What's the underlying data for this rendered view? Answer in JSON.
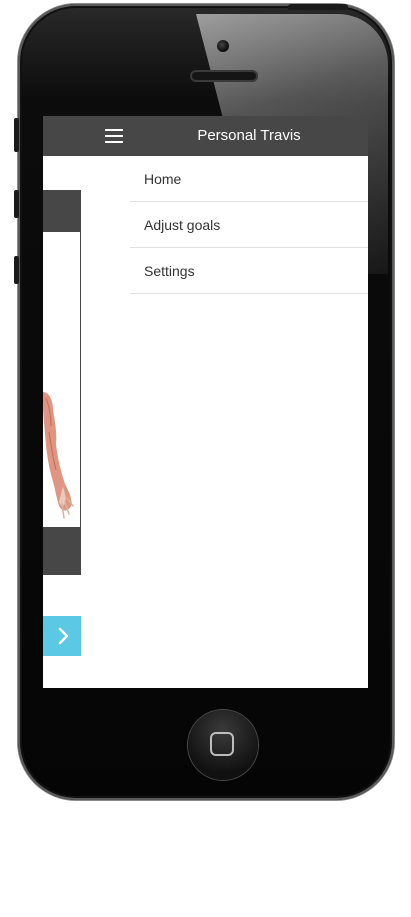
{
  "header": {
    "title": "Personal Travis"
  },
  "menu": {
    "items": [
      {
        "label": "Home"
      },
      {
        "label": "Adjust goals"
      },
      {
        "label": "Settings"
      }
    ]
  },
  "icons": {
    "menu": "hamburger-icon",
    "next": "chevron-right-icon",
    "home": "home-button"
  },
  "colors": {
    "header_bg": "#474747",
    "accent": "#5bc8e6",
    "text": "#333333"
  }
}
